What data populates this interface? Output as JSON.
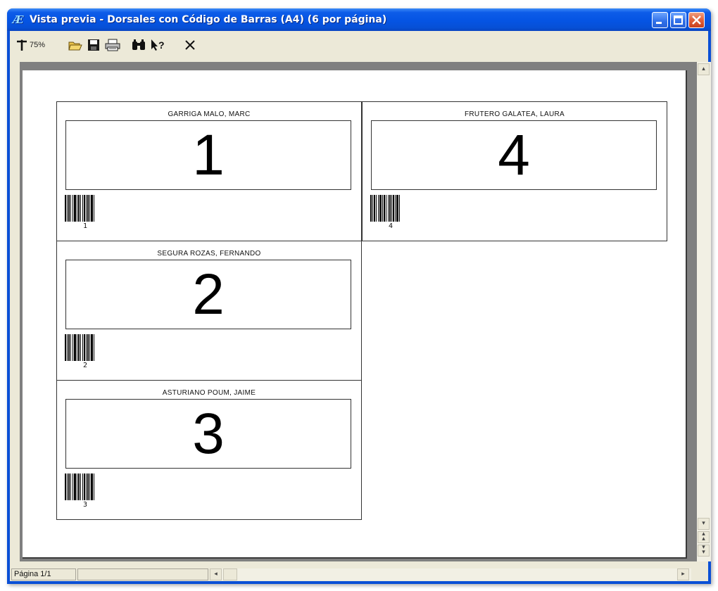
{
  "window": {
    "title": "Vista previa - Dorsales con Código de Barras (A4) (6 por página)"
  },
  "toolbar": {
    "zoom_label": "75%",
    "icons": [
      "zoom-pointer-icon",
      "open-folder-icon",
      "save-icon",
      "print-icon",
      "find-icon",
      "help-pointer-icon",
      "close-icon"
    ]
  },
  "labels": [
    {
      "name": "GARRIGA MALO, MARC",
      "number": "1",
      "barcode_text": "1"
    },
    {
      "name": "FRUTERO GALATEA, LAURA",
      "number": "4",
      "barcode_text": "4"
    },
    {
      "name": "SEGURA ROZAS, FERNANDO",
      "number": "2",
      "barcode_text": "2"
    },
    {
      "name": "ASTURIANO POUM, JAIME",
      "number": "3",
      "barcode_text": "3"
    }
  ],
  "statusbar": {
    "page_label": "Página 1/1"
  },
  "colors": {
    "title_bar": "#0554e3",
    "close_button": "#e0603a",
    "chrome": "#ece9d8",
    "preview_background": "#808080"
  }
}
